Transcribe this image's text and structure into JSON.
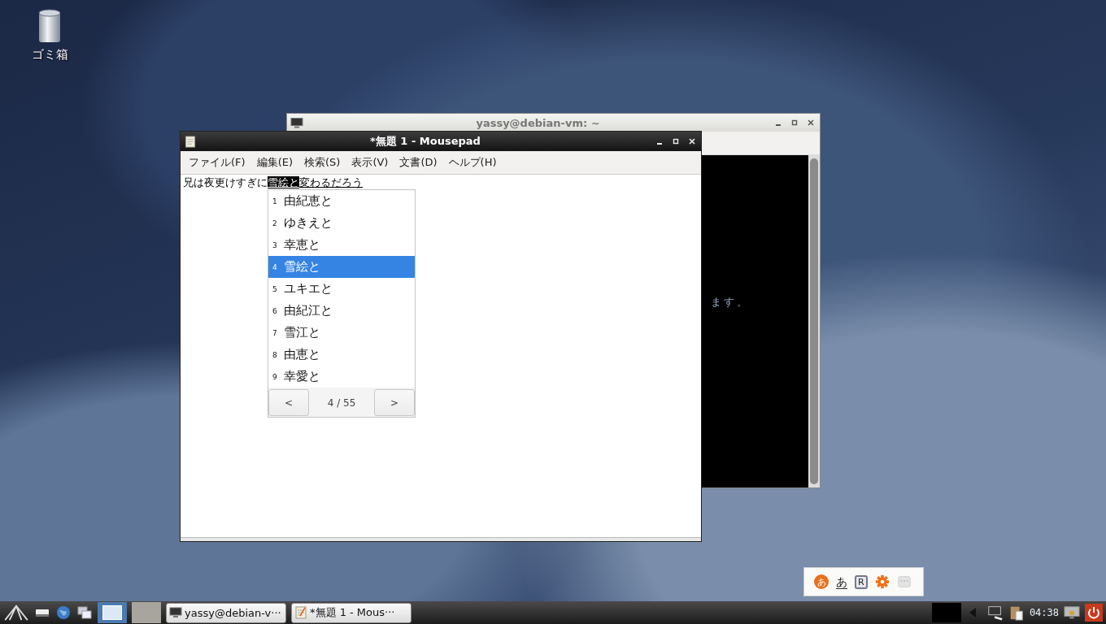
{
  "desktop": {
    "icons": [
      {
        "label": "ゴミ箱"
      }
    ]
  },
  "terminal_window": {
    "title": "yassy@debian-vm: ~",
    "visible_output": "ます。"
  },
  "editor_window": {
    "title": "*無題 1 - Mousepad",
    "menu": [
      "ファイル(F)",
      "編集(E)",
      "検索(S)",
      "表示(V)",
      "文書(D)",
      "ヘルプ(H)"
    ],
    "text": {
      "committed": "兄は夜更けすぎに",
      "preedit_selected": "雪絵と",
      "preedit_rest": "変わるだろう"
    }
  },
  "candidate_window": {
    "items": [
      {
        "number": "1",
        "text": "由紀恵と",
        "selected": false
      },
      {
        "number": "2",
        "text": "ゆきえと",
        "selected": false
      },
      {
        "number": "3",
        "text": "幸恵と",
        "selected": false
      },
      {
        "number": "4",
        "text": "雪絵と",
        "selected": true
      },
      {
        "number": "5",
        "text": "ユキエと",
        "selected": false
      },
      {
        "number": "6",
        "text": "由紀江と",
        "selected": false
      },
      {
        "number": "7",
        "text": "雪江と",
        "selected": false
      },
      {
        "number": "8",
        "text": "由恵と",
        "selected": false
      },
      {
        "number": "9",
        "text": "幸愛と",
        "selected": false
      }
    ],
    "prev": "<",
    "page": "4 / 55",
    "next": ">"
  },
  "input_method_bar": {
    "logo_glyph": "あ",
    "mode": "あ",
    "register": "R"
  },
  "taskbar": {
    "desktops": [
      {
        "selected": true
      },
      {
        "selected": false
      }
    ],
    "tasks": [
      {
        "kind": "terminal",
        "label": "yassy@debian-v···"
      },
      {
        "kind": "editor",
        "label": "*無題 1 - Mous···"
      }
    ],
    "clock": "04:38"
  }
}
